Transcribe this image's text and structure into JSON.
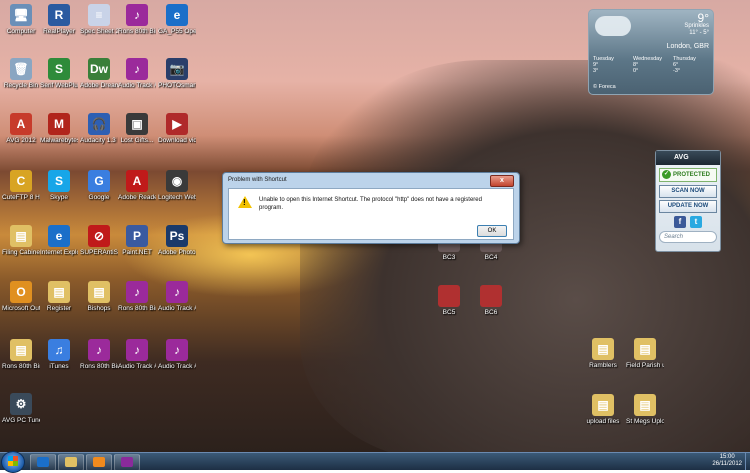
{
  "desktop": {
    "icons": [
      {
        "label": "Computer",
        "glyph": "🖥",
        "color": "#6a8fb8"
      },
      {
        "label": "RealPlayer",
        "glyph": "R",
        "color": "#2a5aa0"
      },
      {
        "label": "Spec Sheet 2",
        "glyph": "≡",
        "color": "#c9d3e8"
      },
      {
        "label": "Rons 80th Birthday",
        "glyph": "♪",
        "color": "#9b2a9b"
      },
      {
        "label": "GA_P55 Operating...",
        "glyph": "e",
        "color": "#1b6fc9"
      },
      {
        "label": "Recycle Bin",
        "glyph": "🗑",
        "color": "#8aa6c2"
      },
      {
        "label": "Serif WebPlus X5",
        "glyph": "S",
        "color": "#2e8b3a"
      },
      {
        "label": "Adobe Dreamwea...",
        "glyph": "Dw",
        "color": "#3a7f3a"
      },
      {
        "label": "Audio Track #8",
        "glyph": "♪",
        "color": "#9b2a9b"
      },
      {
        "label": "PHOTOsmart 2.0 SE",
        "glyph": "📷",
        "color": "#2a3e6a"
      },
      {
        "label": "AVG 2012",
        "glyph": "A",
        "color": "#c73b2b"
      },
      {
        "label": "Malwarebytes Anti-Malw...",
        "glyph": "M",
        "color": "#b1251c"
      },
      {
        "label": "Audacity 1.3 Beta (Unic...",
        "glyph": "🎧",
        "color": "#2d5fb3"
      },
      {
        "label": "Lost Gifts...",
        "glyph": "▣",
        "color": "#3a3a3a"
      },
      {
        "label": "Download video on...",
        "glyph": "▶",
        "color": "#b02a2a"
      },
      {
        "label": "CuteFTP 8 Home",
        "glyph": "C",
        "color": "#d8a423"
      },
      {
        "label": "Skype",
        "glyph": "S",
        "color": "#17a6e8"
      },
      {
        "label": "Google",
        "glyph": "G",
        "color": "#3a7ee0"
      },
      {
        "label": "Adobe Reader 9",
        "glyph": "A",
        "color": "#c01a1a"
      },
      {
        "label": "Logitech Webca...",
        "glyph": "◉",
        "color": "#3a3a3a"
      },
      {
        "label": "Filing Cabinet",
        "glyph": "▤",
        "color": "#e0c064"
      },
      {
        "label": "Internet Explorer",
        "glyph": "e",
        "color": "#1b6fc9"
      },
      {
        "label": "SUPERAntiSpy... Free Edition",
        "glyph": "⊘",
        "color": "#c01a1a"
      },
      {
        "label": "Paint.NET",
        "glyph": "P",
        "color": "#3a5aa0"
      },
      {
        "label": "Adobe Photosh...",
        "glyph": "Ps",
        "color": "#1a3a6a"
      },
      {
        "label": "Microsoft Outlook 2010",
        "glyph": "O",
        "color": "#e09020"
      },
      {
        "label": "Register",
        "glyph": "▤",
        "color": "#e0c064"
      },
      {
        "label": "Bishops",
        "glyph": "▤",
        "color": "#e0c064"
      },
      {
        "label": "Rons 80th Birthday",
        "glyph": "♪",
        "color": "#9b2a9b"
      },
      {
        "label": "Audio Track #3",
        "glyph": "♪",
        "color": "#9b2a9b"
      },
      {
        "label": "Rons 80th Birthday_p...",
        "glyph": "▤",
        "color": "#e0c064"
      },
      {
        "label": "iTunes",
        "glyph": "♫",
        "color": "#3a7ee0"
      },
      {
        "label": "Rons 80th Birthday",
        "glyph": "♪",
        "color": "#9b2a9b"
      },
      {
        "label": "Audio Track #12",
        "glyph": "♪",
        "color": "#9b2a9b"
      },
      {
        "label": "Audio Track #10",
        "glyph": "♪",
        "color": "#9b2a9b"
      },
      {
        "label": "AVG PC Tuneup 2011",
        "glyph": "⚙",
        "color": "#3a4a5a"
      }
    ],
    "right_icons": [
      {
        "label": "BC3",
        "glyph": "",
        "color": "#6a5a5a"
      },
      {
        "label": "BC4",
        "glyph": "",
        "color": "#6a5a5a"
      },
      {
        "label": "BC5",
        "glyph": "",
        "color": "#b03030"
      },
      {
        "label": "BC6",
        "glyph": "",
        "color": "#b03030"
      },
      {
        "label": "Ramblers",
        "glyph": "▤",
        "color": "#e0c064"
      },
      {
        "label": "Field Parish upload",
        "glyph": "▤",
        "color": "#e0c064"
      },
      {
        "label": "upload files",
        "glyph": "▤",
        "color": "#e0c064"
      },
      {
        "label": "St Megs Upload",
        "glyph": "▤",
        "color": "#e0c064"
      }
    ]
  },
  "weather": {
    "temp": "9°",
    "condition": "Sprinkles",
    "range": "11° - 5°",
    "city": "London, GBR",
    "forecast": [
      {
        "day": "Tuesday",
        "hi": "9°",
        "lo": "3°"
      },
      {
        "day": "Wednesday",
        "hi": "8°",
        "lo": "0°"
      },
      {
        "day": "Thursday",
        "hi": "6°",
        "lo": "-3°"
      }
    ],
    "footer": "© Foreca"
  },
  "avg": {
    "brand": "AVG",
    "status": "PROTECTED",
    "scan_label": "SCAN NOW",
    "update_label": "UPDATE NOW",
    "search_placeholder": "Search",
    "facebook": "f",
    "twitter": "t"
  },
  "dialog": {
    "title": "Problem with Shortcut",
    "close": "x",
    "message": "Unable to open this Internet Shortcut. The protocol \"http\" does not have a registered program.",
    "ok_label": "OK"
  },
  "taskbar": {
    "time": "15:00",
    "date": "26/11/2012"
  }
}
